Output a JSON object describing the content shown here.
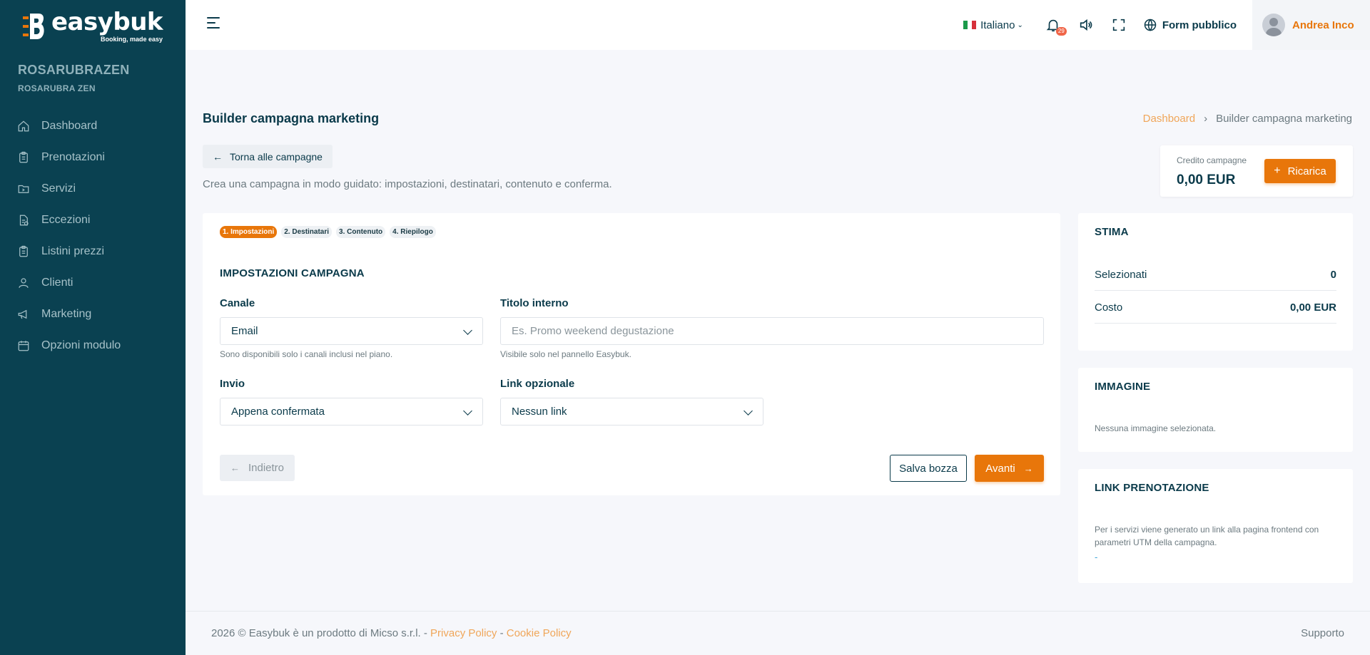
{
  "brand": {
    "name": "easybuk",
    "tagline": "Booking, made easy"
  },
  "org": {
    "name": "ROSARUBRAZEN",
    "subtitle": "ROSARUBRA ZEN"
  },
  "sidebar": {
    "items": [
      {
        "label": "Dashboard",
        "icon": "home-icon"
      },
      {
        "label": "Prenotazioni",
        "icon": "clipboard-icon"
      },
      {
        "label": "Servizi",
        "icon": "folder-icon"
      },
      {
        "label": "Eccezioni",
        "icon": "document-exception-icon"
      },
      {
        "label": "Listini prezzi",
        "icon": "price-list-icon"
      },
      {
        "label": "Clienti",
        "icon": "user-icon"
      },
      {
        "label": "Marketing",
        "icon": "megaphone-icon"
      },
      {
        "label": "Opzioni modulo",
        "icon": "calendar-icon"
      }
    ]
  },
  "topbar": {
    "language": "Italiano",
    "notifications_count": "29",
    "public_form": "Form pubblico",
    "user_name": "Andrea Inco"
  },
  "page": {
    "title": "Builder campagna marketing",
    "breadcrumb": {
      "home": "Dashboard",
      "current": "Builder campagna marketing"
    },
    "back_label": "Torna alle campagne",
    "intro": "Crea una campagna in modo guidato: impostazioni, destinatari, contenuto e conferma."
  },
  "credit": {
    "label": "Credito campagne",
    "value": "0,00 EUR",
    "recharge_label": "Ricarica"
  },
  "wizard": {
    "steps": [
      "1. Impostazioni",
      "2. Destinatari",
      "3. Contenuto",
      "4. Riepilogo"
    ],
    "active_step": 0,
    "section_title": "IMPOSTAZIONI CAMPAGNA",
    "channel": {
      "label": "Canale",
      "value": "Email",
      "hint": "Sono disponibili solo i canali inclusi nel piano."
    },
    "internal_title": {
      "label": "Titolo interno",
      "placeholder": "Es. Promo weekend degustazione",
      "value": "",
      "hint": "Visibile solo nel pannello Easybuk."
    },
    "send": {
      "label": "Invio",
      "value": "Appena confermata"
    },
    "optional_link": {
      "label": "Link opzionale",
      "value": "Nessun link"
    },
    "buttons": {
      "prev": "Indietro",
      "draft": "Salva bozza",
      "next": "Avanti"
    }
  },
  "estimate": {
    "title": "STIMA",
    "rows": [
      {
        "label": "Selezionati",
        "value": "0"
      },
      {
        "label": "Costo",
        "value": "0,00 EUR"
      }
    ]
  },
  "image_panel": {
    "title": "IMMAGINE",
    "text": "Nessuna immagine selezionata."
  },
  "booking_link": {
    "title": "LINK PRENOTAZIONE",
    "text": "Per i servizi viene generato un link alla pagina frontend con parametri UTM della campagna.",
    "link": "-"
  },
  "footer": {
    "copyright": "2026 © Easybuk è un prodotto di Micso s.r.l. - ",
    "privacy": "Privacy Policy",
    "separator": " - ",
    "cookie": "Cookie Policy",
    "support": "Supporto"
  },
  "colors": {
    "sidebar": "#0a4151",
    "accent": "#e8760a",
    "link": "#f0a659",
    "text": "#0a3a4a"
  }
}
